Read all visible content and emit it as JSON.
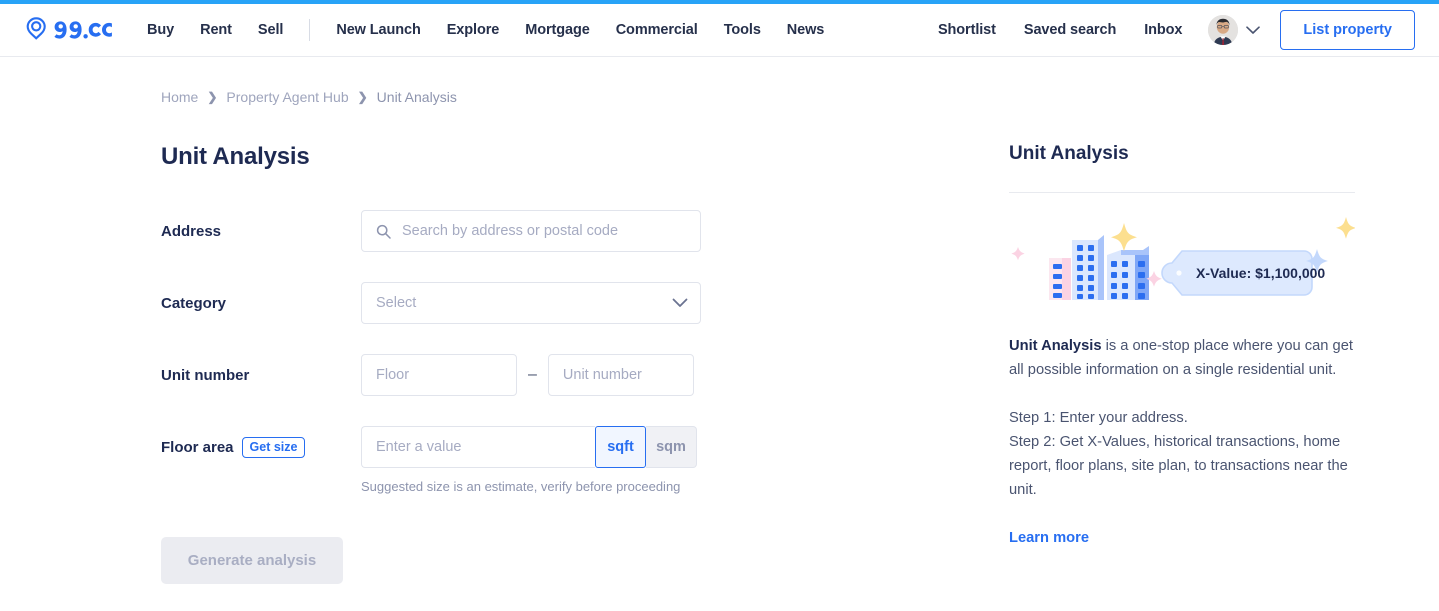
{
  "brand": {
    "logo_text": "99.co",
    "accent": "#276ef1",
    "loading_bar_color": "#27a3f7",
    "text_dark": "#1e2a52"
  },
  "navbar": {
    "primary_links": [
      "Buy",
      "Rent",
      "Sell"
    ],
    "secondary_links": [
      "New Launch",
      "Explore",
      "Mortgage",
      "Commercial",
      "Tools",
      "News"
    ],
    "right_links": [
      "Shortlist",
      "Saved search",
      "Inbox"
    ],
    "account_chevron_icon": "chevron-down-icon",
    "avatar_icon": "user-avatar",
    "list_property_label": "List property"
  },
  "breadcrumb": {
    "items": [
      "Home",
      "Property Agent Hub",
      "Unit Analysis"
    ],
    "separator_icon": "chevron-right-icon"
  },
  "main": {
    "title": "Unit Analysis",
    "form": {
      "address": {
        "label": "Address",
        "placeholder": "Search by address or postal code",
        "value": "",
        "icon": "search-icon"
      },
      "category": {
        "label": "Category",
        "placeholder": "Select",
        "value": "",
        "icon": "chevron-down-icon"
      },
      "unit_number": {
        "label": "Unit number",
        "floor_placeholder": "Floor",
        "floor_value": "",
        "separator": "–",
        "unit_placeholder": "Unit number",
        "unit_value": ""
      },
      "floor_area": {
        "label": "Floor area",
        "get_size_label": "Get size",
        "placeholder": "Enter a value",
        "value": "",
        "units": [
          "sqft",
          "sqm"
        ],
        "selected_unit": "sqft",
        "hint": "Suggested size is an estimate, verify before proceeding"
      },
      "submit_label": "Generate analysis",
      "submit_disabled": true
    }
  },
  "side_panel": {
    "title": "Unit Analysis",
    "illustration": {
      "name": "buildings-price-tag-illustration",
      "tag_label": "X-Value: $1,100,000",
      "sparkles": [
        "pink",
        "yellow",
        "blue",
        "pink",
        "blue",
        "yellow"
      ]
    },
    "body_bold": "Unit Analysis",
    "body_rest": " is a one-stop place where you can get all possible information on a single residential unit.",
    "step1": "Step 1: Enter your address.",
    "step2": "Step 2: Get X-Values, historical transactions, home report, floor plans, site plan, to transactions near the unit.",
    "learn_more_label": "Learn more"
  }
}
